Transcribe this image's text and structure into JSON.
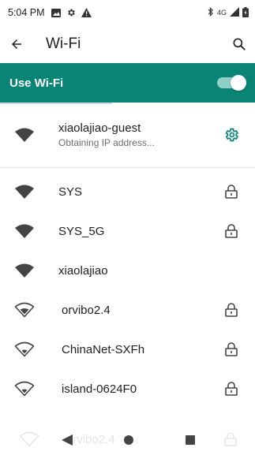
{
  "status_bar": {
    "time": "5:04 PM",
    "network": "4G"
  },
  "app_bar": {
    "title": "Wi-Fi"
  },
  "toggle": {
    "label": "Use Wi-Fi",
    "state": "on"
  },
  "connected": {
    "ssid": "xiaolajiao-guest",
    "status": "Obtaining IP address..."
  },
  "networks": [
    {
      "ssid": "SYS",
      "signal": "full",
      "secured": true
    },
    {
      "ssid": "SYS_5G",
      "signal": "full",
      "secured": true
    },
    {
      "ssid": "xiaolajiao",
      "signal": "full",
      "secured": false
    },
    {
      "ssid": "orvibo2.4",
      "signal": "outline",
      "secured": true
    },
    {
      "ssid": "ChinaNet-SXFh",
      "signal": "outline",
      "secured": true
    },
    {
      "ssid": "island-0624F0",
      "signal": "outline",
      "secured": true
    }
  ],
  "ghost_item": {
    "ssid": "orvibo2.4"
  },
  "colors": {
    "accent": "#0a8575",
    "toggle_track": "#8fd0c6"
  }
}
